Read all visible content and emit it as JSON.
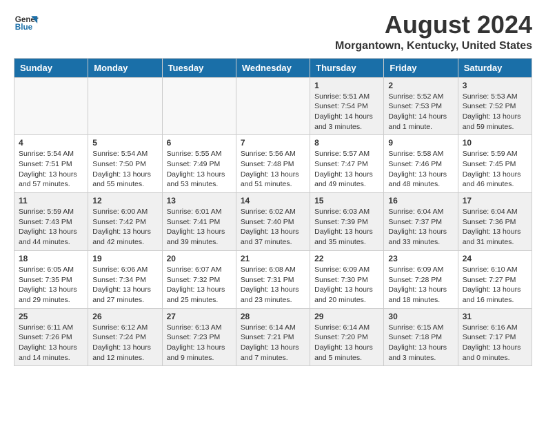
{
  "logo": {
    "line1": "General",
    "line2": "Blue"
  },
  "title": "August 2024",
  "subtitle": "Morgantown, Kentucky, United States",
  "headers": [
    "Sunday",
    "Monday",
    "Tuesday",
    "Wednesday",
    "Thursday",
    "Friday",
    "Saturday"
  ],
  "weeks": [
    [
      {
        "day": "",
        "info": ""
      },
      {
        "day": "",
        "info": ""
      },
      {
        "day": "",
        "info": ""
      },
      {
        "day": "",
        "info": ""
      },
      {
        "day": "1",
        "info": "Sunrise: 5:51 AM\nSunset: 7:54 PM\nDaylight: 14 hours\nand 3 minutes."
      },
      {
        "day": "2",
        "info": "Sunrise: 5:52 AM\nSunset: 7:53 PM\nDaylight: 14 hours\nand 1 minute."
      },
      {
        "day": "3",
        "info": "Sunrise: 5:53 AM\nSunset: 7:52 PM\nDaylight: 13 hours\nand 59 minutes."
      }
    ],
    [
      {
        "day": "4",
        "info": "Sunrise: 5:54 AM\nSunset: 7:51 PM\nDaylight: 13 hours\nand 57 minutes."
      },
      {
        "day": "5",
        "info": "Sunrise: 5:54 AM\nSunset: 7:50 PM\nDaylight: 13 hours\nand 55 minutes."
      },
      {
        "day": "6",
        "info": "Sunrise: 5:55 AM\nSunset: 7:49 PM\nDaylight: 13 hours\nand 53 minutes."
      },
      {
        "day": "7",
        "info": "Sunrise: 5:56 AM\nSunset: 7:48 PM\nDaylight: 13 hours\nand 51 minutes."
      },
      {
        "day": "8",
        "info": "Sunrise: 5:57 AM\nSunset: 7:47 PM\nDaylight: 13 hours\nand 49 minutes."
      },
      {
        "day": "9",
        "info": "Sunrise: 5:58 AM\nSunset: 7:46 PM\nDaylight: 13 hours\nand 48 minutes."
      },
      {
        "day": "10",
        "info": "Sunrise: 5:59 AM\nSunset: 7:45 PM\nDaylight: 13 hours\nand 46 minutes."
      }
    ],
    [
      {
        "day": "11",
        "info": "Sunrise: 5:59 AM\nSunset: 7:43 PM\nDaylight: 13 hours\nand 44 minutes."
      },
      {
        "day": "12",
        "info": "Sunrise: 6:00 AM\nSunset: 7:42 PM\nDaylight: 13 hours\nand 42 minutes."
      },
      {
        "day": "13",
        "info": "Sunrise: 6:01 AM\nSunset: 7:41 PM\nDaylight: 13 hours\nand 39 minutes."
      },
      {
        "day": "14",
        "info": "Sunrise: 6:02 AM\nSunset: 7:40 PM\nDaylight: 13 hours\nand 37 minutes."
      },
      {
        "day": "15",
        "info": "Sunrise: 6:03 AM\nSunset: 7:39 PM\nDaylight: 13 hours\nand 35 minutes."
      },
      {
        "day": "16",
        "info": "Sunrise: 6:04 AM\nSunset: 7:37 PM\nDaylight: 13 hours\nand 33 minutes."
      },
      {
        "day": "17",
        "info": "Sunrise: 6:04 AM\nSunset: 7:36 PM\nDaylight: 13 hours\nand 31 minutes."
      }
    ],
    [
      {
        "day": "18",
        "info": "Sunrise: 6:05 AM\nSunset: 7:35 PM\nDaylight: 13 hours\nand 29 minutes."
      },
      {
        "day": "19",
        "info": "Sunrise: 6:06 AM\nSunset: 7:34 PM\nDaylight: 13 hours\nand 27 minutes."
      },
      {
        "day": "20",
        "info": "Sunrise: 6:07 AM\nSunset: 7:32 PM\nDaylight: 13 hours\nand 25 minutes."
      },
      {
        "day": "21",
        "info": "Sunrise: 6:08 AM\nSunset: 7:31 PM\nDaylight: 13 hours\nand 23 minutes."
      },
      {
        "day": "22",
        "info": "Sunrise: 6:09 AM\nSunset: 7:30 PM\nDaylight: 13 hours\nand 20 minutes."
      },
      {
        "day": "23",
        "info": "Sunrise: 6:09 AM\nSunset: 7:28 PM\nDaylight: 13 hours\nand 18 minutes."
      },
      {
        "day": "24",
        "info": "Sunrise: 6:10 AM\nSunset: 7:27 PM\nDaylight: 13 hours\nand 16 minutes."
      }
    ],
    [
      {
        "day": "25",
        "info": "Sunrise: 6:11 AM\nSunset: 7:26 PM\nDaylight: 13 hours\nand 14 minutes."
      },
      {
        "day": "26",
        "info": "Sunrise: 6:12 AM\nSunset: 7:24 PM\nDaylight: 13 hours\nand 12 minutes."
      },
      {
        "day": "27",
        "info": "Sunrise: 6:13 AM\nSunset: 7:23 PM\nDaylight: 13 hours\nand 9 minutes."
      },
      {
        "day": "28",
        "info": "Sunrise: 6:14 AM\nSunset: 7:21 PM\nDaylight: 13 hours\nand 7 minutes."
      },
      {
        "day": "29",
        "info": "Sunrise: 6:14 AM\nSunset: 7:20 PM\nDaylight: 13 hours\nand 5 minutes."
      },
      {
        "day": "30",
        "info": "Sunrise: 6:15 AM\nSunset: 7:18 PM\nDaylight: 13 hours\nand 3 minutes."
      },
      {
        "day": "31",
        "info": "Sunrise: 6:16 AM\nSunset: 7:17 PM\nDaylight: 13 hours\nand 0 minutes."
      }
    ]
  ]
}
